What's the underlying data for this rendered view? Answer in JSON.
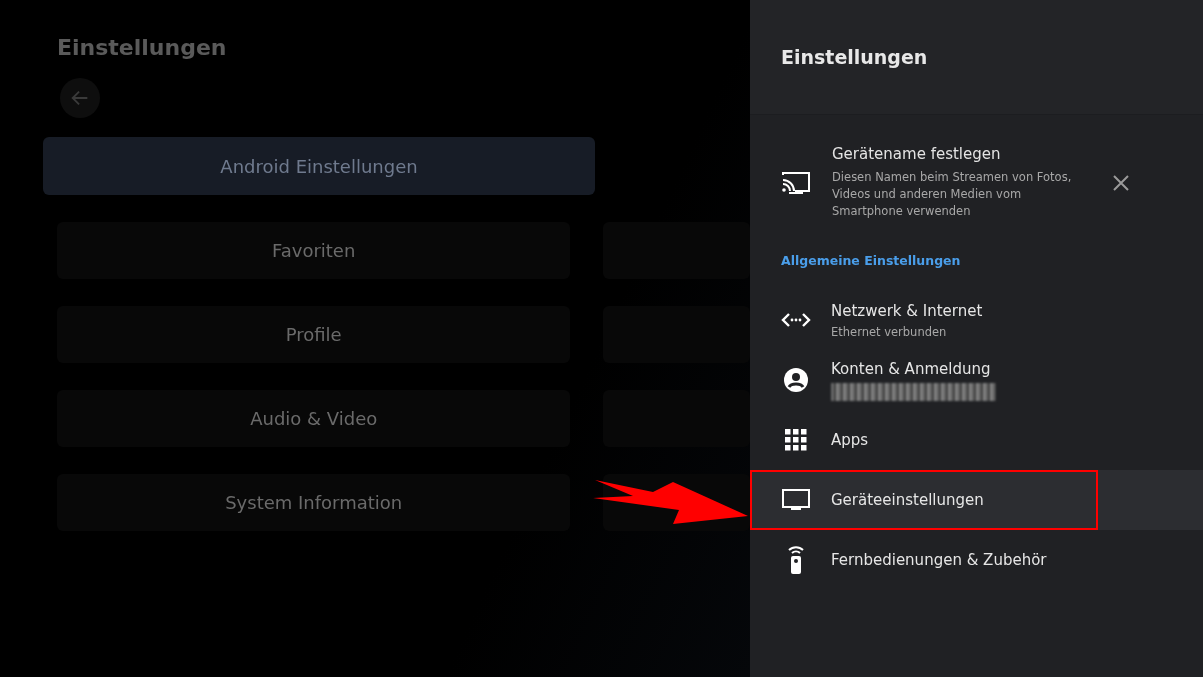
{
  "background": {
    "title": "Einstellungen",
    "tiles": [
      {
        "label": "Android Einstellungen",
        "selected": true
      },
      {
        "label": "Favoriten",
        "selected": false
      },
      {
        "label": "Profile",
        "selected": false
      },
      {
        "label": "Audio & Video",
        "selected": false
      },
      {
        "label": "System Information",
        "selected": false
      }
    ]
  },
  "panel": {
    "title": "Einstellungen",
    "suggestion": {
      "title": "Gerätename festlegen",
      "description": "Diesen Namen beim Streamen von Fotos, Videos und anderen Medien vom Smartphone verwenden"
    },
    "section": "Allgemeine Einstellungen",
    "items": [
      {
        "title": "Netzwerk & Internet",
        "subtitle": "Ethernet verbunden",
        "redacted": false,
        "selected": false,
        "highlighted": false
      },
      {
        "title": "Konten & Anmeldung",
        "redacted": true,
        "selected": false,
        "highlighted": false
      },
      {
        "title": "Apps",
        "redacted": false,
        "selected": false,
        "highlighted": false
      },
      {
        "title": "Geräteeinstellungen",
        "redacted": false,
        "selected": true,
        "highlighted": true
      },
      {
        "title": "Fernbedienungen & Zubehör",
        "redacted": false,
        "selected": false,
        "highlighted": false
      }
    ]
  }
}
